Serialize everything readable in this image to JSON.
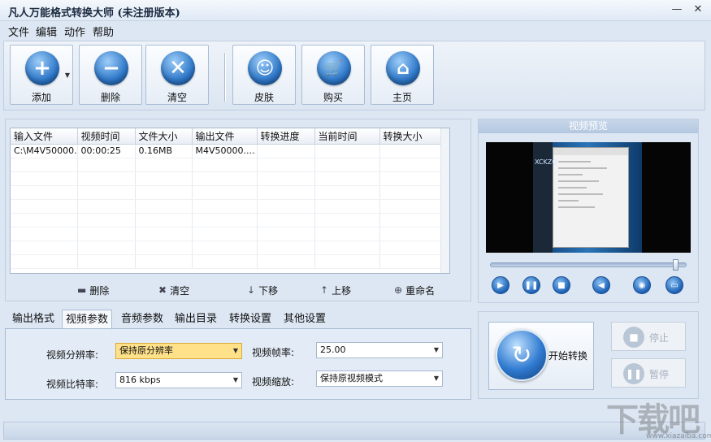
{
  "app": {
    "title": "凡人万能格式转换大师  (未注册版本)"
  },
  "window_controls": {
    "minimize": "—",
    "close": "✕"
  },
  "menu": [
    "文件",
    "编辑",
    "动作",
    "帮助"
  ],
  "toolbar": {
    "buttons": [
      {
        "label": "添加",
        "icon": "plus-icon",
        "color": "#2f78c9"
      },
      {
        "label": "删除",
        "icon": "minus-icon",
        "color": "#2f78c9"
      },
      {
        "label": "清空",
        "icon": "x-icon",
        "color": "#2f78c9"
      },
      {
        "label": "皮肤",
        "icon": "smiley-icon",
        "color": "#2f78c9"
      },
      {
        "label": "购买",
        "icon": "cart-icon",
        "color": "#2f78c9"
      },
      {
        "label": "主页",
        "icon": "home-icon",
        "color": "#2f78c9"
      }
    ]
  },
  "file_list": {
    "columns": [
      "输入文件",
      "视频时间",
      "文件大小",
      "输出文件",
      "转换进度",
      "当前时间",
      "转换大小"
    ],
    "rows": [
      [
        "C:\\M4V50000...",
        "00:00:25",
        "0.16MB",
        "M4V50000....",
        "",
        "",
        ""
      ]
    ]
  },
  "list_actions": {
    "delete": "删除",
    "clear": "清空",
    "down": "下移",
    "up": "上移",
    "rename": "重命名"
  },
  "preview": {
    "title": "视频预览",
    "video_text": "XCKZQ",
    "seek_position": 0.96
  },
  "tabs": [
    "输出格式",
    "视频参数",
    "音频参数",
    "输出目录",
    "转换设置",
    "其他设置"
  ],
  "active_tab": "视频参数",
  "video_params": {
    "resolution_label": "视频分辨率:",
    "resolution_value": "保持原分辨率",
    "framerate_label": "视频帧率:",
    "framerate_value": "25.00",
    "bitrate_label": "视频比特率:",
    "bitrate_value": "816 kbps",
    "scale_label": "视频缩放:",
    "scale_value": "保持原视频模式"
  },
  "convert": {
    "start": "开始转换",
    "stop": "停止",
    "pause": "暂停"
  },
  "watermark": {
    "main": "下载吧",
    "sub": "www.xiazaiba.com"
  }
}
